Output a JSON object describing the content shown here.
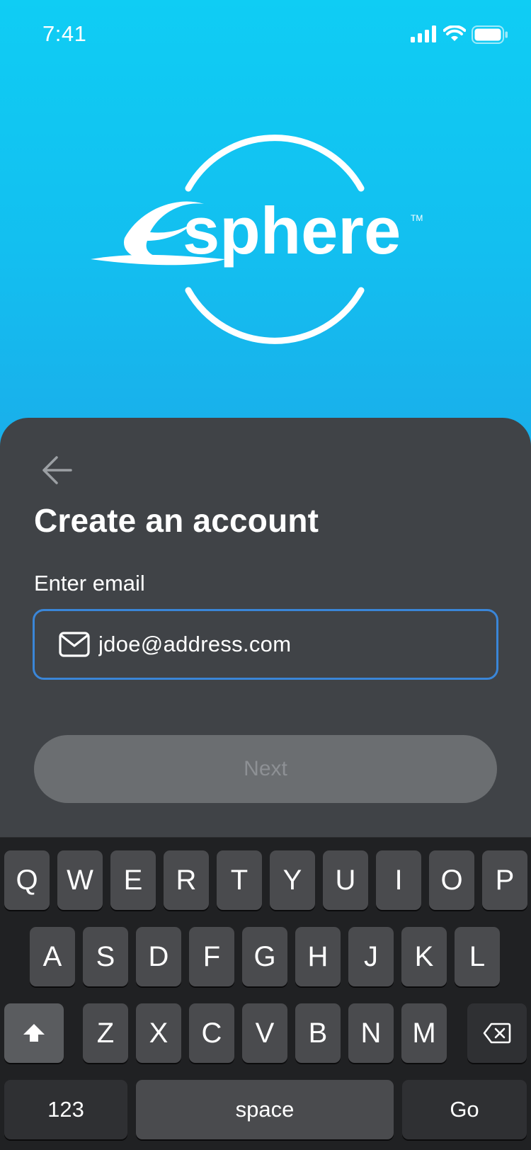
{
  "status_bar": {
    "time": "7:41",
    "icons": [
      "signal-icon",
      "wifi-icon",
      "battery-icon"
    ]
  },
  "brand": {
    "logo_text": "sphere",
    "logo_mark": "e",
    "trademark": "TM"
  },
  "form": {
    "title": "Create an account",
    "email_label": "Enter email",
    "email_value": "jdoe@address.com",
    "next_label": "Next",
    "back_icon": "arrow-left-icon",
    "field_icon": "mail-icon"
  },
  "keyboard": {
    "row1": [
      "Q",
      "W",
      "E",
      "R",
      "T",
      "Y",
      "U",
      "I",
      "O",
      "P"
    ],
    "row2": [
      "A",
      "S",
      "D",
      "F",
      "G",
      "H",
      "J",
      "K",
      "L"
    ],
    "row3": [
      "Z",
      "X",
      "C",
      "V",
      "B",
      "N",
      "M"
    ],
    "shift_icon": "shift-icon",
    "delete_icon": "backspace-icon",
    "numbers_label": "123",
    "space_label": "space",
    "go_label": "Go"
  },
  "colors": {
    "hero_top": "#0fcdf4",
    "hero_bottom": "#1aaeea",
    "sheet": "#404347",
    "field_border": "#3a86d8",
    "button_disabled": "#6b6e71"
  }
}
